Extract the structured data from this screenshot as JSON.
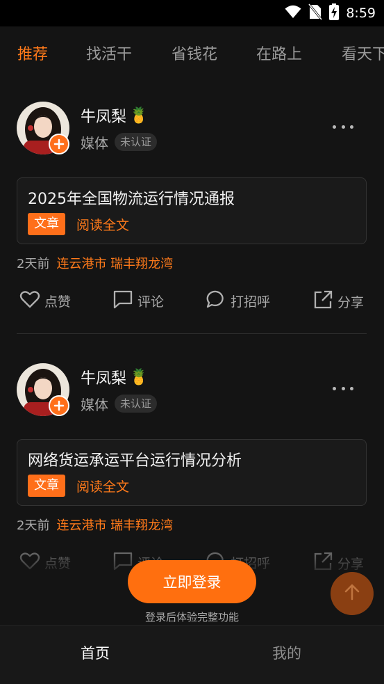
{
  "status_bar": {
    "time": "8:59",
    "icons": [
      "wifi-icon",
      "no-sim-icon",
      "battery-charging-icon"
    ]
  },
  "tabs": [
    {
      "label": "推荐",
      "active": true
    },
    {
      "label": "找活干",
      "active": false
    },
    {
      "label": "省钱花",
      "active": false
    },
    {
      "label": "在路上",
      "active": false
    },
    {
      "label": "看天下",
      "active": false
    }
  ],
  "posts": [
    {
      "author": {
        "name": "牛凤梨",
        "emoji": "🍍",
        "role": "媒体",
        "badge": "未认证"
      },
      "card": {
        "title": "2025年全国物流运行情况通报",
        "tag": "文章",
        "link": "阅读全文"
      },
      "time": "2天前",
      "location": "连云港市 瑞丰翔龙湾",
      "actions": {
        "like": "点赞",
        "comment": "评论",
        "greet": "打招呼",
        "share": "分享"
      }
    },
    {
      "author": {
        "name": "牛凤梨",
        "emoji": "🍍",
        "role": "媒体",
        "badge": "未认证"
      },
      "card": {
        "title": "网络货运承运平台运行情况分析",
        "tag": "文章",
        "link": "阅读全文"
      },
      "time": "2天前",
      "location": "连云港市 瑞丰翔龙湾",
      "actions": {
        "like": "点赞",
        "comment": "评论",
        "greet": "打招呼",
        "share": "分享"
      }
    }
  ],
  "login": {
    "button_label": "立即登录",
    "hint": "登录后体验完整功能"
  },
  "bottom_nav": [
    {
      "label": "首页",
      "active": true
    },
    {
      "label": "我的",
      "active": false
    }
  ],
  "colors": {
    "accent": "#ff7a1a",
    "background": "#141414",
    "text": "#eaeaea",
    "muted": "#a8a8a8"
  }
}
